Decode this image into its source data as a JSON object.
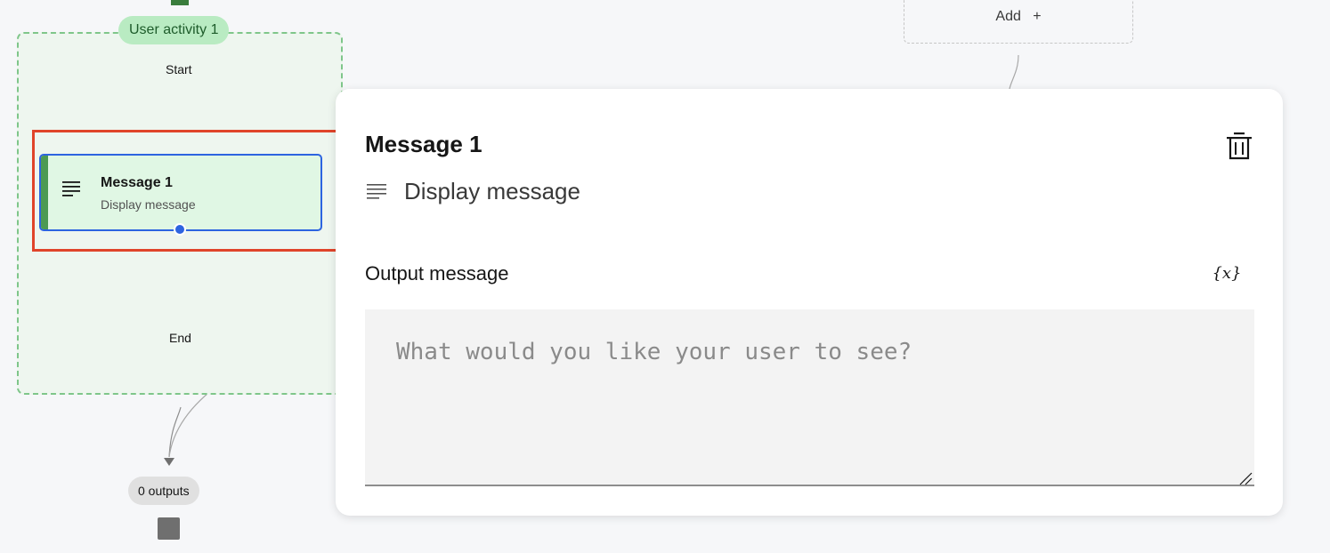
{
  "canvas": {
    "activity_group_label": "User activity 1",
    "start_label": "Start",
    "end_label": "End",
    "outputs_label": "0 outputs",
    "add_label": "Add",
    "add_symbol": "+"
  },
  "node": {
    "title": "Message 1",
    "subtitle": "Display message",
    "icon": "text-lines-icon"
  },
  "panel": {
    "title": "Message 1",
    "type_label": "Display message",
    "type_icon": "text-lines-icon",
    "delete_icon": "trash-icon",
    "output_label": "Output message",
    "variable_button": "{x}",
    "textarea_value": "",
    "textarea_placeholder": "What would you like your user to see?"
  },
  "colors": {
    "selection_highlight": "#e0442a",
    "selected_node_border": "#2d64e0",
    "activity_group_border": "#7fc68a",
    "node_accent": "#4c9a53"
  }
}
